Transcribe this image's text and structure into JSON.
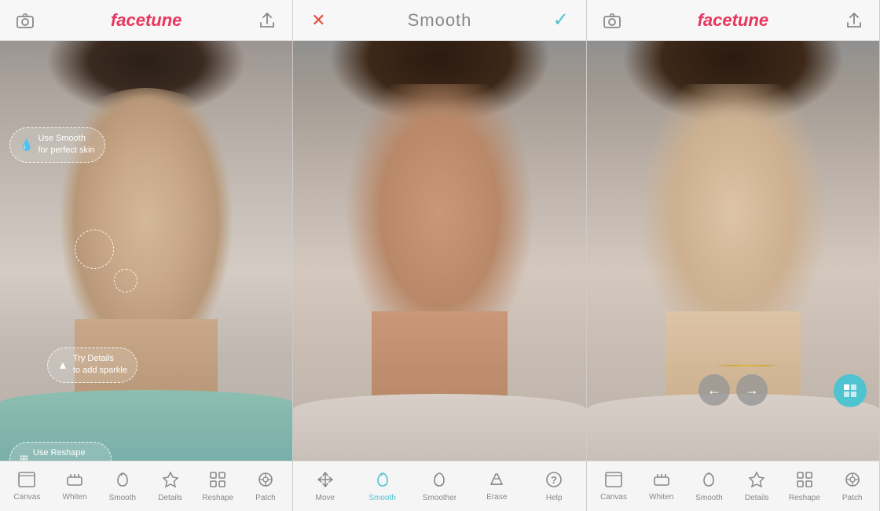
{
  "panels": [
    {
      "id": "left",
      "topbar": {
        "left_icon": "camera-icon",
        "logo": "facetune",
        "right_icon": "share-icon"
      },
      "annotations": [
        {
          "id": "smooth-tip",
          "text": "Use Smooth\nfor perfect skin",
          "icon": "💧",
          "style": "top:108px;left:10px;"
        },
        {
          "id": "details-tip",
          "text": "Try Details\nto add sparkle",
          "icon": "🔺",
          "style": "top:390px;left:55px;"
        },
        {
          "id": "reshape-tip",
          "text": "Use Reshape\nto resize the nose",
          "icon": "⊞",
          "style": "top:508px;left:10px;"
        }
      ],
      "toolbar": {
        "items": [
          {
            "id": "canvas",
            "label": "Canvas",
            "icon": "canvas"
          },
          {
            "id": "whiten",
            "label": "Whiten",
            "icon": "whiten"
          },
          {
            "id": "smooth",
            "label": "Smooth",
            "icon": "smooth"
          },
          {
            "id": "details",
            "label": "Details",
            "icon": "details"
          },
          {
            "id": "reshape",
            "label": "Reshape",
            "icon": "reshape"
          },
          {
            "id": "patch",
            "label": "Patch",
            "icon": "patch"
          }
        ]
      }
    },
    {
      "id": "middle",
      "topbar": {
        "left_icon": "cancel-icon",
        "title": "Smooth",
        "right_icon": "confirm-icon"
      },
      "toolbar": {
        "items": [
          {
            "id": "move",
            "label": "Move",
            "icon": "move",
            "active": false
          },
          {
            "id": "smooth",
            "label": "Smooth",
            "icon": "smooth",
            "active": true
          },
          {
            "id": "smoother",
            "label": "Smoother",
            "icon": "smoother",
            "active": false
          },
          {
            "id": "erase",
            "label": "Erase",
            "icon": "erase",
            "active": false
          },
          {
            "id": "help",
            "label": "Help",
            "icon": "help",
            "active": false
          }
        ]
      }
    },
    {
      "id": "right",
      "topbar": {
        "left_icon": "camera-icon",
        "logo": "facetune",
        "right_icon": "share-icon"
      },
      "toolbar": {
        "items": [
          {
            "id": "canvas",
            "label": "Canvas",
            "icon": "canvas"
          },
          {
            "id": "whiten",
            "label": "Whiten",
            "icon": "whiten"
          },
          {
            "id": "smooth",
            "label": "Smooth",
            "icon": "smooth"
          },
          {
            "id": "details",
            "label": "Details",
            "icon": "details"
          },
          {
            "id": "reshape",
            "label": "Reshape",
            "icon": "reshape"
          },
          {
            "id": "patch",
            "label": "Patch",
            "icon": "patch"
          }
        ]
      }
    }
  ],
  "colors": {
    "logo": "#e8365d",
    "active": "#4fc3d0",
    "cancel": "#e74c3c",
    "toolbar_bg": "#f5f5f5",
    "topbar_bg": "#f7f7f7"
  },
  "labels": {
    "title": "Smooth",
    "logo_face": "face",
    "logo_tune": "tune"
  }
}
